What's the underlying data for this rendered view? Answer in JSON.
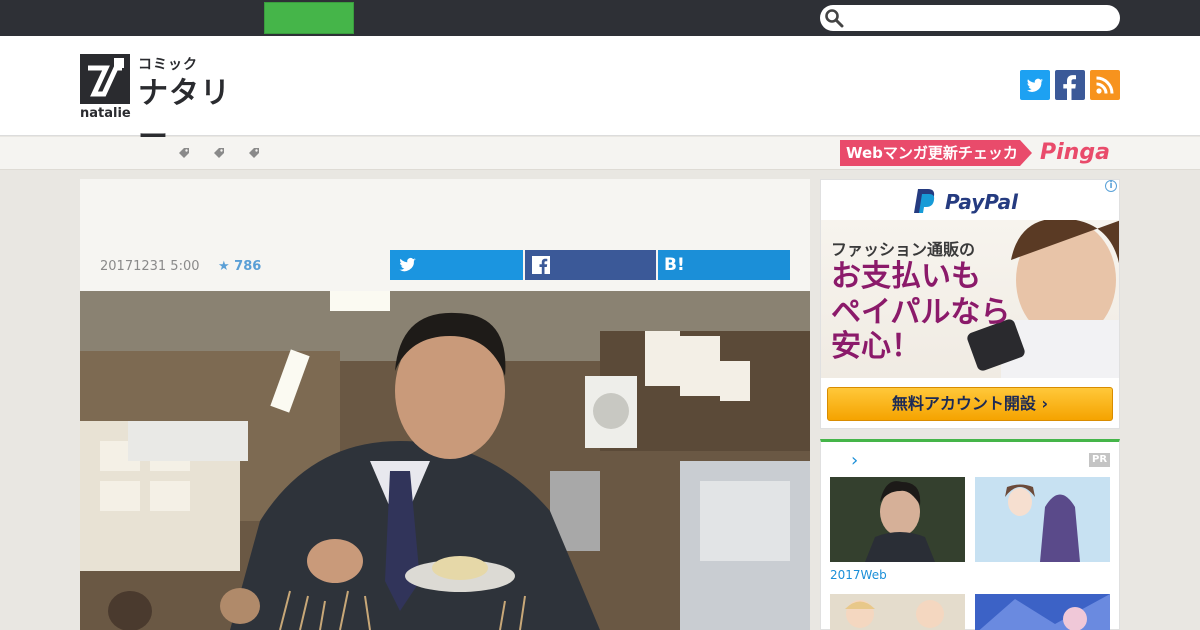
{
  "topbar": {
    "search": {
      "placeholder": ""
    }
  },
  "header": {
    "logo_small": "コミック",
    "logo_big": "ナタリー",
    "logo_en": "natalie",
    "social": [
      "twitter-icon",
      "facebook-icon",
      "rss-icon"
    ]
  },
  "tagbar": {
    "pinga_label": "Webマンガ更新チェッカー",
    "pinga_logo": "Pinga"
  },
  "article": {
    "date": "20171231 5:00",
    "star_count": "★ 786",
    "share_hb_label": "B!"
  },
  "ad": {
    "brand": "PayPal",
    "line1": "ファッション通販の",
    "line2": "お支払いも",
    "line3": "ペイパルなら",
    "line4": "安心！",
    "cta": "無料アカウント開設 ›"
  },
  "pr": {
    "arrow": "›",
    "badge": "PR",
    "caption": "2017Web"
  },
  "colors": {
    "topbar": "#2e3036",
    "accent_green": "#45b549",
    "twitter": "#1da1f2",
    "facebook": "#3b5998",
    "rss": "#f7931e",
    "pinga": "#e94b6b",
    "paypal_navy": "#253b80"
  }
}
